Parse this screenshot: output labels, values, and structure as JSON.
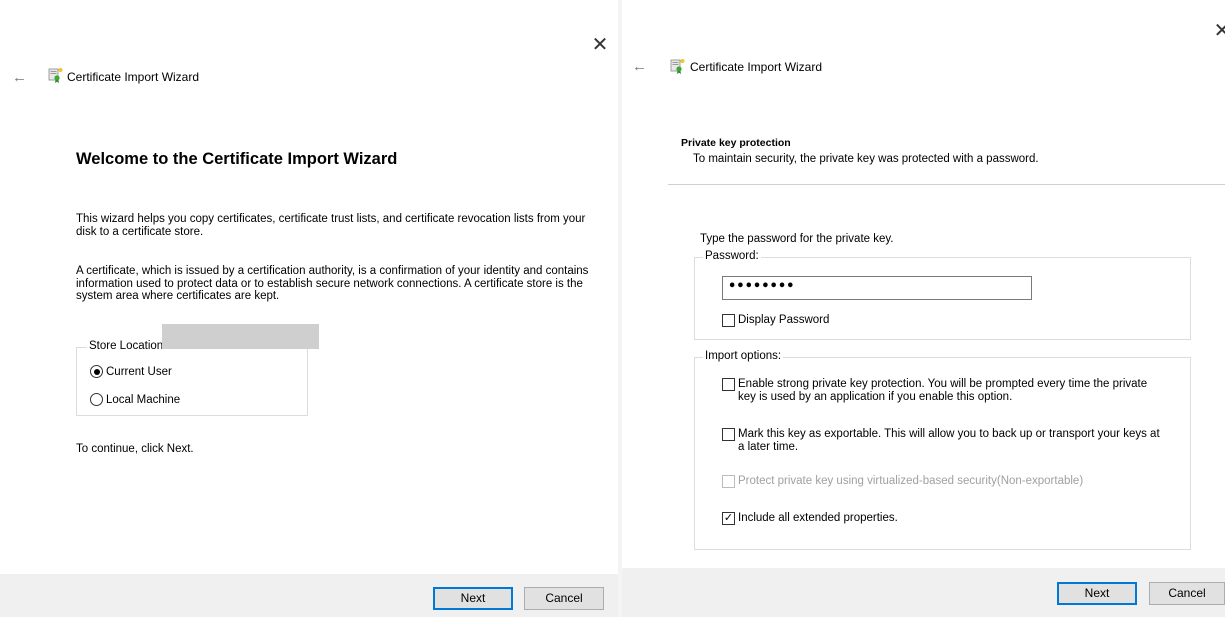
{
  "left": {
    "close_glyph": "✕",
    "back_glyph": "←",
    "wizard_title": "Certificate Import Wizard",
    "heading": "Welcome to the Certificate Import Wizard",
    "paragraph1": "This wizard helps you copy certificates, certificate trust lists, and certificate revocation lists from your disk to a certificate store.",
    "paragraph2": "A certificate, which is issued by a certification authority, is a confirmation of your identity and contains information used to protect data or to establish secure network connections. A certificate store is the system area where certificates are kept.",
    "store_location_label": "Store Location",
    "store_options": [
      {
        "label": "Current User",
        "selected": true
      },
      {
        "label": "Local Machine",
        "selected": false
      }
    ],
    "continue_text": "To continue, click Next.",
    "next_label": "Next",
    "cancel_label": "Cancel"
  },
  "right": {
    "close_glyph": "✕",
    "back_glyph": "←",
    "wizard_title": "Certificate Import Wizard",
    "section_title": "Private key protection",
    "section_desc": "To maintain security, the private key was protected with a password.",
    "prompt": "Type the password for the private key.",
    "password_label": "Password:",
    "password_value": "••••••••",
    "display_password_label": "Display Password",
    "display_password_checked": false,
    "import_options_label": "Import options:",
    "options": [
      {
        "label": "Enable strong private key protection. You will be prompted every time the private key is used by an application if you enable this option.",
        "checked": false,
        "enabled": true
      },
      {
        "label": "Mark this key as exportable. This will allow you to back up or transport your keys at a later time.",
        "checked": false,
        "enabled": true
      },
      {
        "label": "Protect private key using virtualized-based security(Non-exportable)",
        "checked": false,
        "enabled": false
      },
      {
        "label": "Include all extended properties.",
        "checked": true,
        "enabled": true
      }
    ],
    "next_label": "Next",
    "cancel_label": "Cancel"
  },
  "colors": {
    "accent": "#0078d7",
    "footer_bg": "#f0f0f0",
    "button_bg": "#e1e1e1"
  }
}
